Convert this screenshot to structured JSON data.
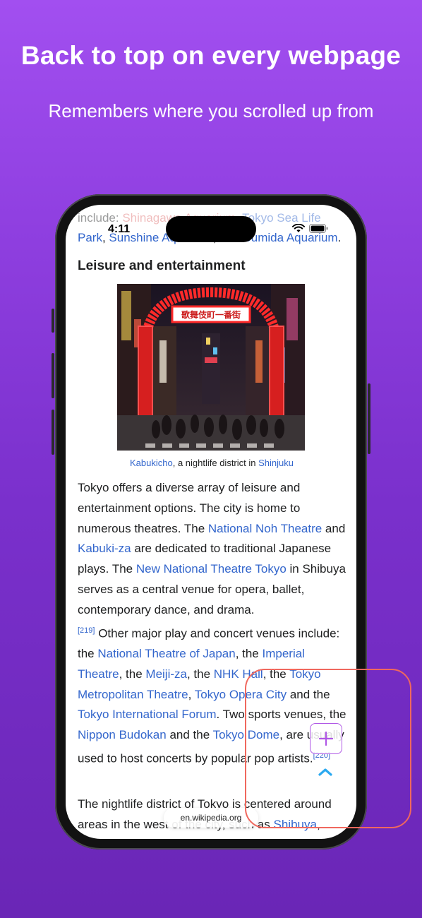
{
  "promo": {
    "title": "Back to top on every webpage",
    "subtitle": "Remembers where you scrolled up from"
  },
  "status_bar": {
    "time": "4:11"
  },
  "article": {
    "pre_text": {
      "lead": "include: ",
      "link1": "Shinagawa Aquarium",
      "sep1": ", ",
      "link2": "Tokyo Sea Life",
      "link3": "Park",
      "sep2": ", ",
      "link4": "Sunshine Aquarium",
      "sep3": ", and ",
      "link5": "Sumida Aquarium",
      "end": "."
    },
    "section_heading": "Leisure and entertainment",
    "photo": {
      "sign_text": "歌舞伎町一番街"
    },
    "caption": {
      "link1": "Kabukicho",
      "text": ", a nightlife district in ",
      "link2": "Shinjuku"
    },
    "paragraph": {
      "t1": "Tokyo offers a diverse array of leisure and entertainment options. The city is home to numerous theatres. The ",
      "l1": "National Noh Theatre",
      "t2": " and ",
      "l2": "Kabuki-za",
      "t3": " are dedicated to traditional Japanese plays. The ",
      "l3": "New National Theatre Tokyo",
      "t4": " in Shibuya serves as a central venue for opera, ballet, contemporary dance, and drama.",
      "ref1": "[219]",
      "t5": " Other major play and concert venues include: the ",
      "l4": "National Theatre of Japan",
      "t6": ", the ",
      "l5": "Imperial Theatre",
      "t7": ", the ",
      "l6": "Meiji-za",
      "t8": ", the ",
      "l7": "NHK Hall",
      "t9": ", the ",
      "l8": "Tokyo Metropolitan Theatre",
      "t10": ", ",
      "l9": "Tokyo Opera City",
      "t11": " and the ",
      "l10": "Tokyo International Forum",
      "t12": ". Two sports venues, the ",
      "l11": "Nippon Budokan",
      "t13": " and the ",
      "l12": "Tokyo Dome",
      "t14": ", are usually used to host concerts by popular pop artists.",
      "ref2": "[220]"
    },
    "paragraph2": {
      "t1": "The nightlife district of Tokyo is centered around areas in the west of the city, such as ",
      "l1": "Shibuya",
      "t2": ","
    }
  },
  "address_bar": {
    "url": "en.wikipedia.org"
  },
  "colors": {
    "link": "#3366cc",
    "highlight": "#f0685e",
    "accent": "#b057e6",
    "back_to_top": "#2ba9f0"
  },
  "icons": {
    "add": "plus-icon",
    "back_to_top": "chevron-up-icon"
  }
}
